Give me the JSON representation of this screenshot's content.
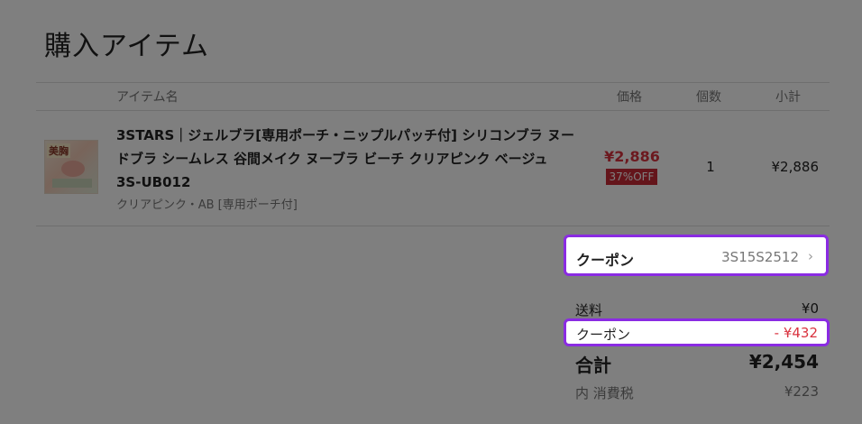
{
  "page_title": "購入アイテム",
  "table_headers": {
    "item": "アイテム名",
    "price": "価格",
    "qty": "個数",
    "subtotal": "小計"
  },
  "item": {
    "image_badge": "美胸",
    "name": "3STARS｜ジェルブラ[専用ポーチ・ニップルパッチ付] シリコンブラ ヌードブラ シームレス 谷間メイク ヌーブラ ビーチ クリアピンク ベージュ 3S-UB012",
    "variant": "クリアピンク・AB [専用ポーチ付]",
    "price": "¥2,886",
    "discount": "37%OFF",
    "qty": "1",
    "subtotal": "¥2,886"
  },
  "coupon_selector": {
    "label": "クーポン",
    "code": "3S15S2512"
  },
  "summary": {
    "shipping_label": "送料",
    "shipping_value": "¥0",
    "coupon_label": "クーポン",
    "coupon_value": "- ¥432",
    "total_label": "合計",
    "total_value": "¥2,454",
    "tax_label": "内 消費税",
    "tax_value": "¥223"
  },
  "colors": {
    "highlight_border": "#8a2be2",
    "price_red": "#d9333f",
    "discount_bg": "#c92b37"
  }
}
